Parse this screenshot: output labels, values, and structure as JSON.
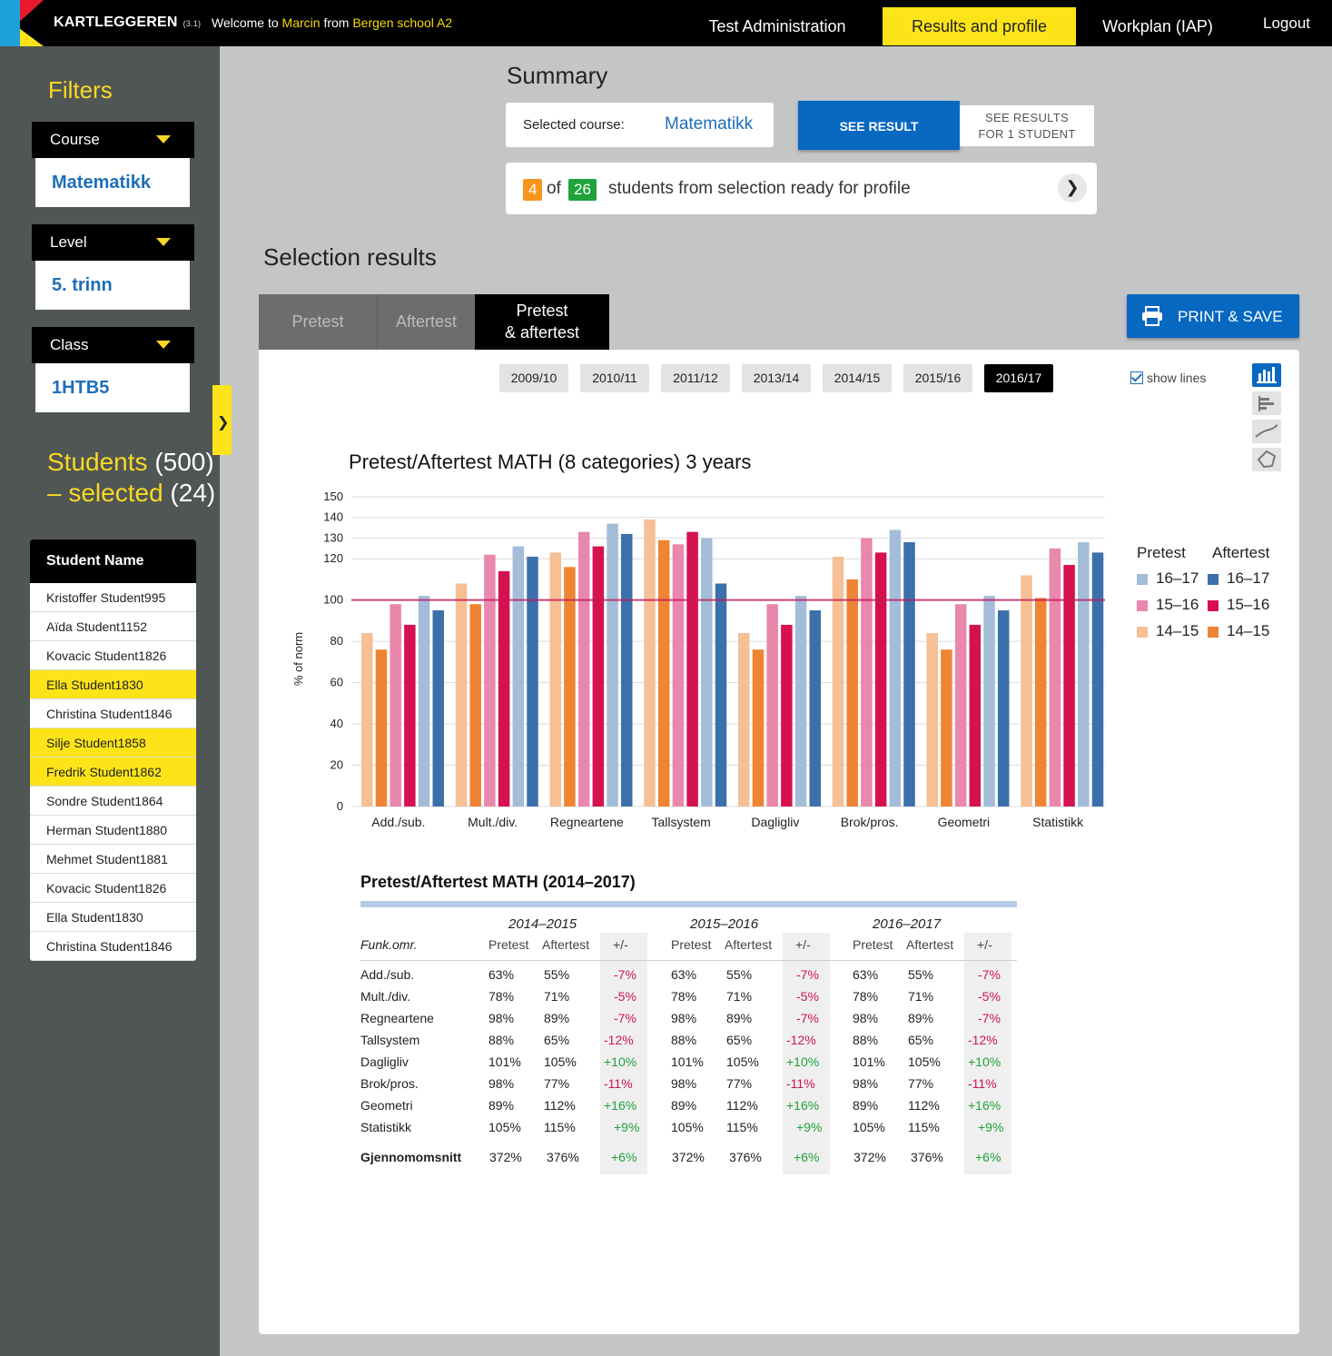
{
  "topbar": {
    "brand": "KARTLEGGEREN",
    "version": "(3.1)",
    "welcome_prefix": "Welcome to ",
    "user": "Marcin",
    "from": " from ",
    "school": "Bergen school A2",
    "nav": [
      "Test Administration",
      "Results and profile",
      "Workplan (IAP)",
      "Logout"
    ],
    "active_nav": "Results and profile"
  },
  "sidebar": {
    "filters_title": "Filters",
    "filters": [
      {
        "label": "Course",
        "value": "Matematikk"
      },
      {
        "label": "Level",
        "value": "5. trinn"
      },
      {
        "label": "Class",
        "value": "1HTB5"
      }
    ],
    "students_label": "Students",
    "students_total": "(500)",
    "selected_label": "– selected",
    "selected_count": "(24)",
    "list_header": "Student Name",
    "students": [
      {
        "name": "Kristoffer Student995",
        "selected": false
      },
      {
        "name": "Aïda Student1152",
        "selected": false
      },
      {
        "name": "Kovacic Student1826",
        "selected": false
      },
      {
        "name": "Ella Student1830",
        "selected": true
      },
      {
        "name": "Christina Student1846",
        "selected": false
      },
      {
        "name": "Silje Student1858",
        "selected": true
      },
      {
        "name": "Fredrik Student1862",
        "selected": true
      },
      {
        "name": "Sondre Student1864",
        "selected": false
      },
      {
        "name": "Herman Student1880",
        "selected": false
      },
      {
        "name": "Mehmet Student1881",
        "selected": false
      },
      {
        "name": "Kovacic Student1826",
        "selected": false
      },
      {
        "name": "Ella Student1830",
        "selected": false
      },
      {
        "name": "Christina Student1846",
        "selected": false
      }
    ]
  },
  "summary": {
    "title": "Summary",
    "course_label": "Selected course:",
    "course_value": "Matematikk",
    "see_result": "SEE RESULT",
    "see_results_1_line1": "SEE RESULTS",
    "see_results_1_line2": "FOR 1 STUDENT",
    "ready_count": "4",
    "ready_of": "of",
    "ready_total": "26",
    "ready_text": "students from selection ready for profile"
  },
  "selection": {
    "title": "Selection results",
    "tabs": [
      "Pretest",
      "Aftertest"
    ],
    "tab_active_line1": "Pretest",
    "tab_active_line2": "& aftertest",
    "print_label": "PRINT & SAVE",
    "years": [
      "2009/10",
      "2010/11",
      "2011/12",
      "2013/14",
      "2014/15",
      "2015/16",
      "2016/17"
    ],
    "active_year": "2016/17",
    "show_lines": "show lines",
    "show_lines_checked": true,
    "view_icons": [
      "bar-chart-icon",
      "horizontal-bar-icon",
      "line-chart-icon",
      "radar-chart-icon"
    ]
  },
  "chart_data": {
    "type": "bar",
    "title": "Pretest/Aftertest MATH (8 categories) 3 years",
    "ylabel": "% of norm",
    "xlabel": "",
    "ylim": [
      0,
      150
    ],
    "yticks": [
      0,
      20,
      40,
      60,
      80,
      100,
      120,
      130,
      140,
      150
    ],
    "reference_line": 100,
    "categories": [
      "Add./sub.",
      "Mult./div.",
      "Regneartene",
      "Tallsystem",
      "Dagligliv",
      "Brok/pros.",
      "Geometri",
      "Statistikk"
    ],
    "legend_pretest": "Pretest",
    "legend_aftertest": "Aftertest",
    "series": [
      {
        "name": "14–15",
        "group": "Pretest",
        "color": "#f6bf94",
        "values": [
          84,
          108,
          123,
          139,
          84,
          121,
          84,
          112
        ]
      },
      {
        "name": "14–15",
        "group": "Aftertest",
        "color": "#ee8434",
        "values": [
          76,
          98,
          116,
          129,
          76,
          110,
          76,
          101
        ]
      },
      {
        "name": "15–16",
        "group": "Pretest",
        "color": "#e987ad",
        "values": [
          98,
          122,
          133,
          127,
          98,
          130,
          98,
          125
        ]
      },
      {
        "name": "15–16",
        "group": "Aftertest",
        "color": "#d61150",
        "values": [
          88,
          114,
          126,
          133,
          88,
          123,
          88,
          117
        ]
      },
      {
        "name": "16–17",
        "group": "Pretest",
        "color": "#a3bdd9",
        "values": [
          102,
          126,
          137,
          130,
          102,
          134,
          102,
          128
        ]
      },
      {
        "name": "16–17",
        "group": "Aftertest",
        "color": "#3b70aa",
        "values": [
          95,
          121,
          132,
          108,
          95,
          128,
          95,
          123
        ]
      }
    ]
  },
  "table": {
    "title": "Pretest/Aftertest MATH (2014–2017)",
    "periods": [
      "2014–2015",
      "2015–2016",
      "2016–2017"
    ],
    "first_col": "Funk.omr.",
    "subheads": [
      "Pretest",
      "Aftertest",
      "+/-"
    ],
    "rows": [
      {
        "label": "Add./sub.",
        "pre": "63%",
        "after": "55%",
        "diff": "-7%",
        "sign": "neg"
      },
      {
        "label": "Mult./div.",
        "pre": "78%",
        "after": "71%",
        "diff": "-5%",
        "sign": "neg"
      },
      {
        "label": "Regneartene",
        "pre": "98%",
        "after": "89%",
        "diff": "-7%",
        "sign": "neg"
      },
      {
        "label": "Tallsystem",
        "pre": "88%",
        "after": "65%",
        "diff": "-12%",
        "sign": "neg"
      },
      {
        "label": "Dagligliv",
        "pre": "101%",
        "after": "105%",
        "diff": "+10%",
        "sign": "pos"
      },
      {
        "label": "Brok/pros.",
        "pre": "98%",
        "after": "77%",
        "diff": "-11%",
        "sign": "neg"
      },
      {
        "label": "Geometri",
        "pre": "89%",
        "after": "112%",
        "diff": "+16%",
        "sign": "pos"
      },
      {
        "label": "Statistikk",
        "pre": "105%",
        "after": "115%",
        "diff": "+9%",
        "sign": "pos"
      }
    ],
    "total": {
      "label": "Gjennomomsnitt",
      "pre": "372%",
      "after": "376%",
      "diff": "+6%",
      "sign": "pos"
    }
  },
  "colors": {
    "accent_yellow": "#fce419",
    "primary_blue": "#0768c2",
    "sidebar_bg": "#4f5654",
    "ready_orange": "#f7941d",
    "ready_green": "#1fa33a"
  }
}
